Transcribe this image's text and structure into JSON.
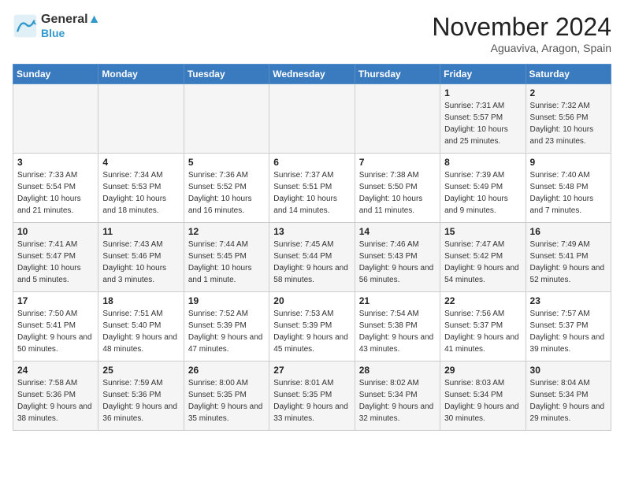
{
  "header": {
    "logo_line1": "General",
    "logo_line2": "Blue",
    "month": "November 2024",
    "location": "Aguaviva, Aragon, Spain"
  },
  "weekdays": [
    "Sunday",
    "Monday",
    "Tuesday",
    "Wednesday",
    "Thursday",
    "Friday",
    "Saturday"
  ],
  "weeks": [
    [
      {
        "day": "",
        "info": ""
      },
      {
        "day": "",
        "info": ""
      },
      {
        "day": "",
        "info": ""
      },
      {
        "day": "",
        "info": ""
      },
      {
        "day": "",
        "info": ""
      },
      {
        "day": "1",
        "info": "Sunrise: 7:31 AM\nSunset: 5:57 PM\nDaylight: 10 hours and 25 minutes."
      },
      {
        "day": "2",
        "info": "Sunrise: 7:32 AM\nSunset: 5:56 PM\nDaylight: 10 hours and 23 minutes."
      }
    ],
    [
      {
        "day": "3",
        "info": "Sunrise: 7:33 AM\nSunset: 5:54 PM\nDaylight: 10 hours and 21 minutes."
      },
      {
        "day": "4",
        "info": "Sunrise: 7:34 AM\nSunset: 5:53 PM\nDaylight: 10 hours and 18 minutes."
      },
      {
        "day": "5",
        "info": "Sunrise: 7:36 AM\nSunset: 5:52 PM\nDaylight: 10 hours and 16 minutes."
      },
      {
        "day": "6",
        "info": "Sunrise: 7:37 AM\nSunset: 5:51 PM\nDaylight: 10 hours and 14 minutes."
      },
      {
        "day": "7",
        "info": "Sunrise: 7:38 AM\nSunset: 5:50 PM\nDaylight: 10 hours and 11 minutes."
      },
      {
        "day": "8",
        "info": "Sunrise: 7:39 AM\nSunset: 5:49 PM\nDaylight: 10 hours and 9 minutes."
      },
      {
        "day": "9",
        "info": "Sunrise: 7:40 AM\nSunset: 5:48 PM\nDaylight: 10 hours and 7 minutes."
      }
    ],
    [
      {
        "day": "10",
        "info": "Sunrise: 7:41 AM\nSunset: 5:47 PM\nDaylight: 10 hours and 5 minutes."
      },
      {
        "day": "11",
        "info": "Sunrise: 7:43 AM\nSunset: 5:46 PM\nDaylight: 10 hours and 3 minutes."
      },
      {
        "day": "12",
        "info": "Sunrise: 7:44 AM\nSunset: 5:45 PM\nDaylight: 10 hours and 1 minute."
      },
      {
        "day": "13",
        "info": "Sunrise: 7:45 AM\nSunset: 5:44 PM\nDaylight: 9 hours and 58 minutes."
      },
      {
        "day": "14",
        "info": "Sunrise: 7:46 AM\nSunset: 5:43 PM\nDaylight: 9 hours and 56 minutes."
      },
      {
        "day": "15",
        "info": "Sunrise: 7:47 AM\nSunset: 5:42 PM\nDaylight: 9 hours and 54 minutes."
      },
      {
        "day": "16",
        "info": "Sunrise: 7:49 AM\nSunset: 5:41 PM\nDaylight: 9 hours and 52 minutes."
      }
    ],
    [
      {
        "day": "17",
        "info": "Sunrise: 7:50 AM\nSunset: 5:41 PM\nDaylight: 9 hours and 50 minutes."
      },
      {
        "day": "18",
        "info": "Sunrise: 7:51 AM\nSunset: 5:40 PM\nDaylight: 9 hours and 48 minutes."
      },
      {
        "day": "19",
        "info": "Sunrise: 7:52 AM\nSunset: 5:39 PM\nDaylight: 9 hours and 47 minutes."
      },
      {
        "day": "20",
        "info": "Sunrise: 7:53 AM\nSunset: 5:39 PM\nDaylight: 9 hours and 45 minutes."
      },
      {
        "day": "21",
        "info": "Sunrise: 7:54 AM\nSunset: 5:38 PM\nDaylight: 9 hours and 43 minutes."
      },
      {
        "day": "22",
        "info": "Sunrise: 7:56 AM\nSunset: 5:37 PM\nDaylight: 9 hours and 41 minutes."
      },
      {
        "day": "23",
        "info": "Sunrise: 7:57 AM\nSunset: 5:37 PM\nDaylight: 9 hours and 39 minutes."
      }
    ],
    [
      {
        "day": "24",
        "info": "Sunrise: 7:58 AM\nSunset: 5:36 PM\nDaylight: 9 hours and 38 minutes."
      },
      {
        "day": "25",
        "info": "Sunrise: 7:59 AM\nSunset: 5:36 PM\nDaylight: 9 hours and 36 minutes."
      },
      {
        "day": "26",
        "info": "Sunrise: 8:00 AM\nSunset: 5:35 PM\nDaylight: 9 hours and 35 minutes."
      },
      {
        "day": "27",
        "info": "Sunrise: 8:01 AM\nSunset: 5:35 PM\nDaylight: 9 hours and 33 minutes."
      },
      {
        "day": "28",
        "info": "Sunrise: 8:02 AM\nSunset: 5:34 PM\nDaylight: 9 hours and 32 minutes."
      },
      {
        "day": "29",
        "info": "Sunrise: 8:03 AM\nSunset: 5:34 PM\nDaylight: 9 hours and 30 minutes."
      },
      {
        "day": "30",
        "info": "Sunrise: 8:04 AM\nSunset: 5:34 PM\nDaylight: 9 hours and 29 minutes."
      }
    ]
  ]
}
